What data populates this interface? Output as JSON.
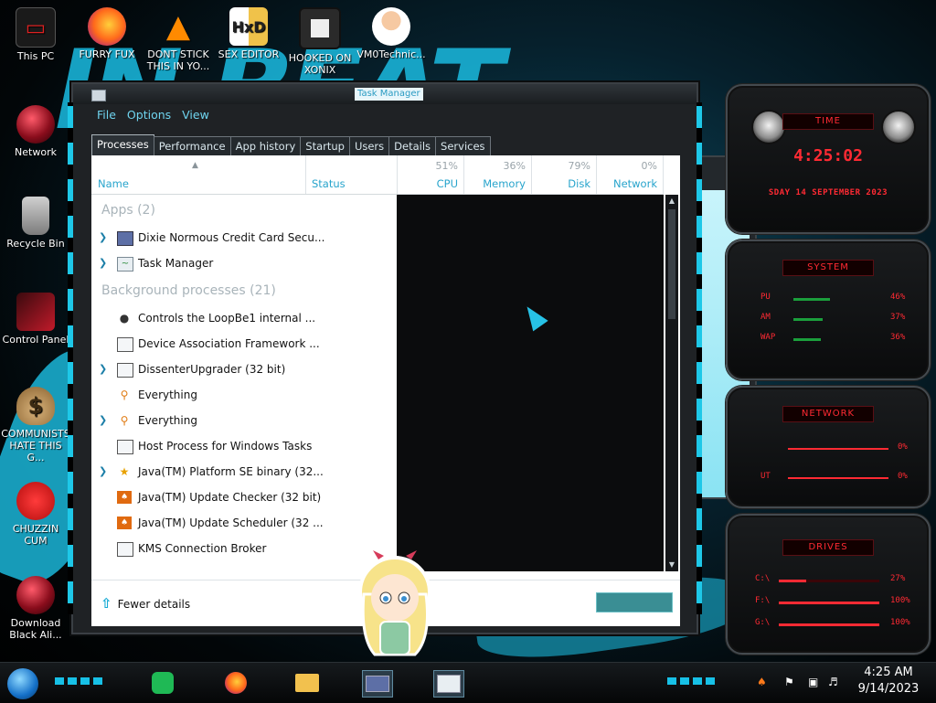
{
  "desktop_icons": [
    {
      "label": "This PC",
      "icon": "pc-icon"
    },
    {
      "label": "FURRY FUX",
      "icon": "firefox-icon"
    },
    {
      "label": "DONT STICK THIS IN YO...",
      "icon": "vlc-icon"
    },
    {
      "label": "SEX EDITOR",
      "icon": "hex-editor-icon"
    },
    {
      "label": "HOOKED ON XONIX",
      "icon": "xonix-icon"
    },
    {
      "label": "VM0Technic...",
      "icon": "doctor-icon"
    },
    {
      "label": "Network",
      "icon": "network-icon"
    },
    {
      "label": "Recycle Bin",
      "icon": "recycle-bin-icon"
    },
    {
      "label": "Control Panel",
      "icon": "control-panel-icon"
    },
    {
      "label": "COMMUNISTS HATE THIS G...",
      "icon": "money-bag-icon"
    },
    {
      "label": "CHUZZIN CUM",
      "icon": "chuzzle-icon"
    },
    {
      "label": "Download Black Ali...",
      "icon": "alienware-icon"
    }
  ],
  "task_manager": {
    "title": "Task Manager",
    "menu": [
      "File",
      "Options",
      "View"
    ],
    "tabs": [
      "Processes",
      "Performance",
      "App history",
      "Startup",
      "Users",
      "Details",
      "Services"
    ],
    "active_tab": "Processes",
    "columns": {
      "name": "Name",
      "status": "Status",
      "cpu": {
        "label": "CPU",
        "pct": "51%"
      },
      "memory": {
        "label": "Memory",
        "pct": "36%"
      },
      "disk": {
        "label": "Disk",
        "pct": "79%"
      },
      "network": {
        "label": "Network",
        "pct": "0%"
      }
    },
    "apps_group": "Apps (2)",
    "apps": [
      {
        "name": "Dixie Normous Credit Card Secu...",
        "expandable": true,
        "icon": "credit-card-icon"
      },
      {
        "name": "Task Manager",
        "expandable": true,
        "icon": "task-manager-icon"
      }
    ],
    "bg_group": "Background processes (21)",
    "background": [
      {
        "name": "Controls the LoopBe1 internal ...",
        "expandable": false,
        "icon": "midi-icon"
      },
      {
        "name": "Device Association Framework ...",
        "expandable": false,
        "icon": "window-icon"
      },
      {
        "name": "DissenterUpgrader (32 bit)",
        "expandable": true,
        "icon": "window-icon"
      },
      {
        "name": "Everything",
        "expandable": false,
        "icon": "magnifier-icon"
      },
      {
        "name": "Everything",
        "expandable": true,
        "icon": "magnifier-icon"
      },
      {
        "name": "Host Process for Windows Tasks",
        "expandable": false,
        "icon": "window-icon"
      },
      {
        "name": "Java(TM) Platform SE binary (32...",
        "expandable": true,
        "icon": "java-icon"
      },
      {
        "name": "Java(TM) Update Checker (32 bit)",
        "expandable": false,
        "icon": "java-update-icon"
      },
      {
        "name": "Java(TM) Update Scheduler (32 ...",
        "expandable": false,
        "icon": "java-update-icon"
      },
      {
        "name": "KMS Connection Broker",
        "expandable": false,
        "icon": "window-icon"
      }
    ],
    "fewer_details": "Fewer details"
  },
  "gadgets": {
    "time": {
      "title": "TIME",
      "time": "4:25:02",
      "date": "SDAY 14 SEPTEMBER 2023"
    },
    "system": {
      "title": "SYSTEM",
      "cpu_label": "PU",
      "cpu_pct": "46%",
      "ram_label": "AM",
      "ram_pct": "37%",
      "swap_label": "WAP",
      "swap_pct": "36%"
    },
    "network": {
      "title": "NETWORK",
      "in_pct": "0%",
      "out_label": "UT",
      "out_pct": "0%"
    },
    "drives": {
      "title": "DRIVES",
      "items": [
        {
          "label": "C:\\",
          "pct": "27%"
        },
        {
          "label": "F:\\",
          "pct": "100%"
        },
        {
          "label": "G:\\",
          "pct": "100%"
        }
      ]
    }
  },
  "taskbar": {
    "clock_time": "4:25 AM",
    "clock_date": "9/14/2023"
  }
}
